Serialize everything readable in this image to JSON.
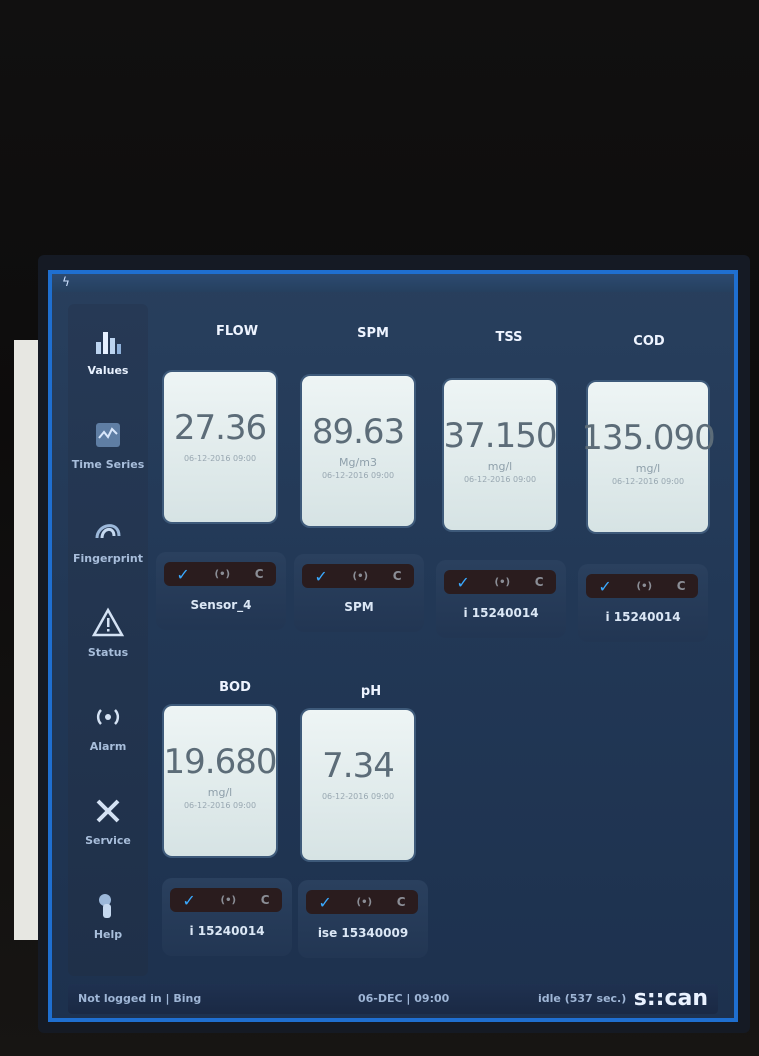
{
  "nav": {
    "items": [
      {
        "label": "Values",
        "icon": "bar-chart-icon"
      },
      {
        "label": "Time Series",
        "icon": "time-series-icon"
      },
      {
        "label": "Fingerprint",
        "icon": "fingerprint-icon"
      },
      {
        "label": "Status",
        "icon": "warning-triangle-icon"
      },
      {
        "label": "Alarm",
        "icon": "alarm-signal-icon"
      },
      {
        "label": "Service",
        "icon": "tools-icon"
      },
      {
        "label": "Help",
        "icon": "help-icon"
      }
    ]
  },
  "tiles": [
    {
      "title": "FLOW",
      "value": "27.36",
      "unit": "",
      "timestamp": "06-12-2016 09:00",
      "sensor": "Sensor_4"
    },
    {
      "title": "SPM",
      "value": "89.63",
      "unit": "Mg/m3",
      "timestamp": "06-12-2016 09:00",
      "sensor": "SPM"
    },
    {
      "title": "TSS",
      "value": "37.150",
      "unit": "mg/l",
      "timestamp": "06-12-2016 09:00",
      "sensor": "i 15240014"
    },
    {
      "title": "COD",
      "value": "135.090",
      "unit": "mg/l",
      "timestamp": "06-12-2016 09:00",
      "sensor": "i 15240014"
    },
    {
      "title": "BOD",
      "value": "19.680",
      "unit": "mg/l",
      "timestamp": "06-12-2016 09:00",
      "sensor": "i 15240014"
    },
    {
      "title": "pH",
      "value": "7.34",
      "unit": "",
      "timestamp": "06-12-2016 09:00",
      "sensor": "ise 15340009"
    }
  ],
  "controls": {
    "check": "✓",
    "hold": "(•)",
    "cal": "C"
  },
  "status": {
    "user": "Not logged in | Bing",
    "datetime": "06-DEC | 09:00",
    "idle": "idle (537 sec.)",
    "brand": "s::can"
  },
  "colors": {
    "screen_border": "#1f6fd0",
    "check": "#3aa9ff",
    "card": "#e4eeef"
  }
}
